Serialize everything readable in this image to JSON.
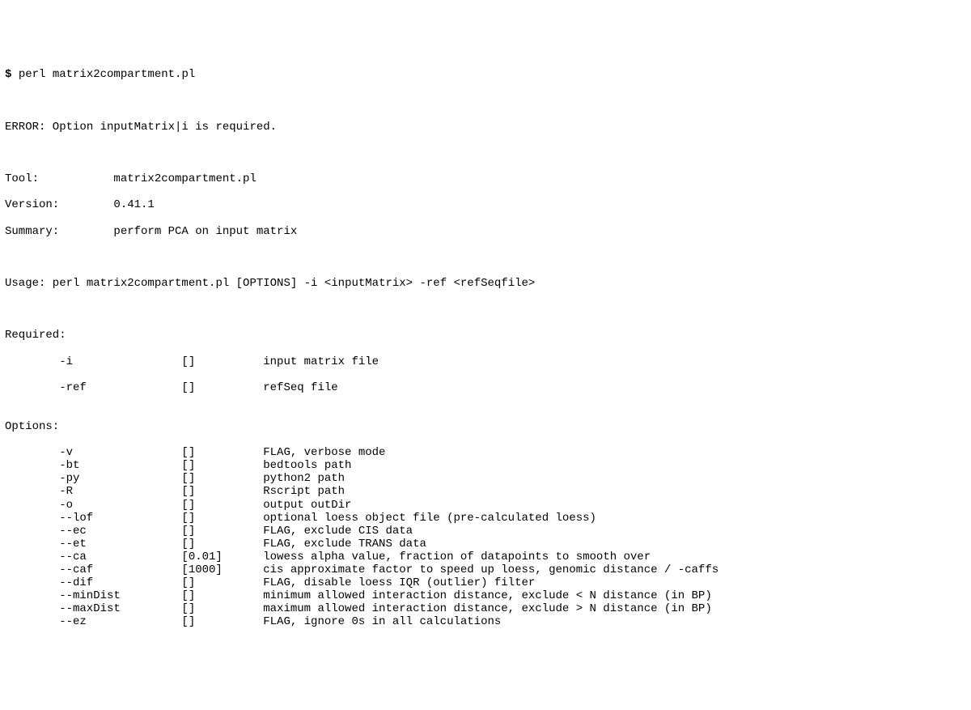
{
  "prompt_symbol": "$",
  "command": "perl matrix2compartment.pl",
  "error_line": "ERROR: Option inputMatrix|i is required.",
  "kv": {
    "tool_key": "Tool:",
    "tool_val": "matrix2compartment.pl",
    "version_key": "Version:",
    "version_val": "0.41.1",
    "summary_key": "Summary:",
    "summary_val": "perform PCA on input matrix"
  },
  "usage_line": "Usage: perl matrix2compartment.pl [OPTIONS] -i <inputMatrix> -ref <refSeqfile>",
  "required_header": "Required:",
  "required": [
    {
      "flag": "-i",
      "default": "[]",
      "desc": "input matrix file"
    },
    {
      "flag": "-ref",
      "default": "[]",
      "desc": "refSeq file"
    }
  ],
  "options_header": "Options:",
  "options": [
    {
      "flag": "-v",
      "default": "[]",
      "desc": "FLAG, verbose mode"
    },
    {
      "flag": "-bt",
      "default": "[]",
      "desc": "bedtools path"
    },
    {
      "flag": "-py",
      "default": "[]",
      "desc": "python2 path"
    },
    {
      "flag": "-R",
      "default": "[]",
      "desc": "Rscript path"
    },
    {
      "flag": "-o",
      "default": "[]",
      "desc": "output outDir"
    },
    {
      "flag": "--lof",
      "default": "[]",
      "desc": "optional loess object file (pre-calculated loess)"
    },
    {
      "flag": "--ec",
      "default": "[]",
      "desc": "FLAG, exclude CIS data"
    },
    {
      "flag": "--et",
      "default": "[]",
      "desc": "FLAG, exclude TRANS data"
    },
    {
      "flag": "--ca",
      "default": "[0.01]",
      "desc": "lowess alpha value, fraction of datapoints to smooth over"
    },
    {
      "flag": "--caf",
      "default": "[1000]",
      "desc": "cis approximate factor to speed up loess, genomic distance / -caffs"
    },
    {
      "flag": "--dif",
      "default": "[]",
      "desc": "FLAG, disable loess IQR (outlier) filter"
    },
    {
      "flag": "--minDist",
      "default": "[]",
      "desc": "minimum allowed interaction distance, exclude < N distance (in BP)"
    },
    {
      "flag": "--maxDist",
      "default": "[]",
      "desc": "maximum allowed interaction distance, exclude > N distance (in BP)"
    },
    {
      "flag": "--ez",
      "default": "[]",
      "desc": "FLAG, ignore 0s in all calculations"
    }
  ]
}
